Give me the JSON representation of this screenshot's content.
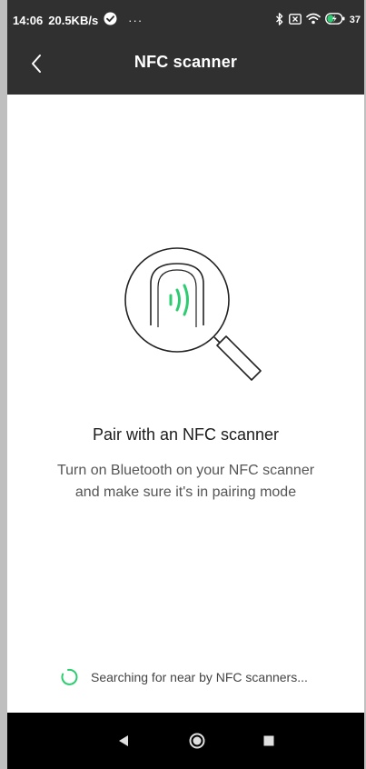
{
  "status_bar": {
    "time": "14:06",
    "speed": "20.5KB/s",
    "more": "···",
    "battery": "37",
    "icons": [
      "check-icon",
      "bluetooth-icon",
      "sim-icon",
      "wifi-icon",
      "battery-icon"
    ]
  },
  "toolbar": {
    "title": "NFC scanner",
    "back_icon": "chevron-left-icon"
  },
  "main": {
    "illustration_icon": "nfc-magnifier-icon",
    "heading": "Pair with an NFC scanner",
    "description_line1": "Turn on Bluetooth on your NFC scanner",
    "description_line2": "and make sure it's in pairing mode",
    "status_text": "Searching for near by NFC scanners...",
    "accent_color": "#2ecc71"
  },
  "nav": {
    "icons": [
      "back-triangle-icon",
      "home-circle-icon",
      "recents-square-icon"
    ]
  }
}
